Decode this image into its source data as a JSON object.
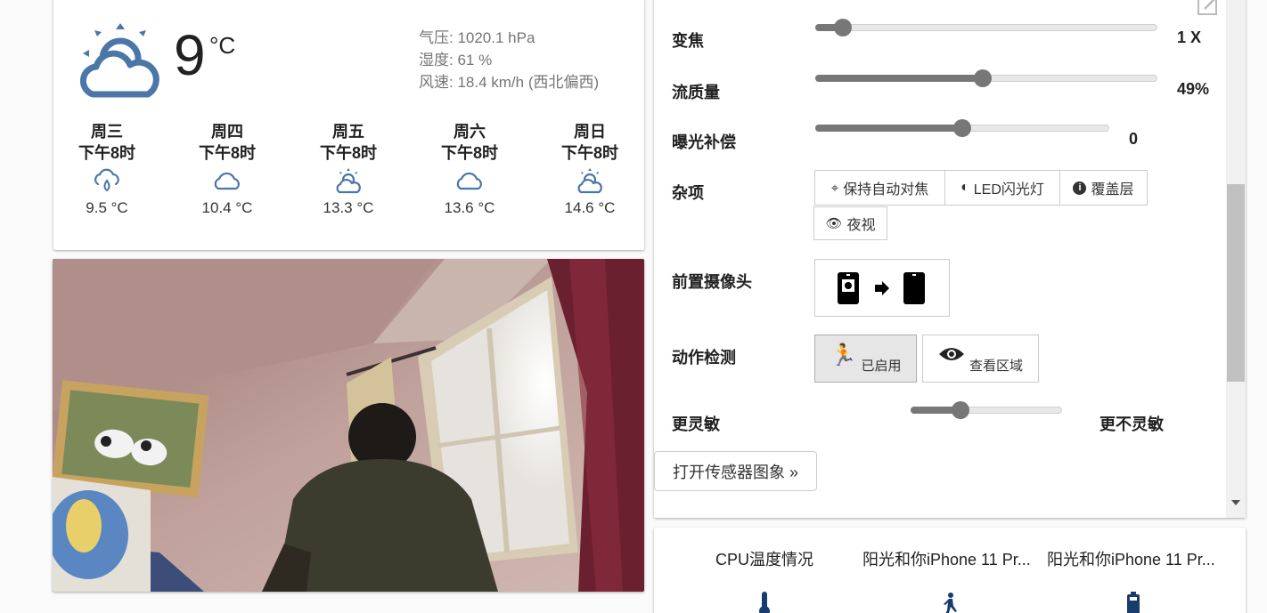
{
  "weather": {
    "current": {
      "temp": "9",
      "unit": "°C",
      "icon": "partly-cloudy-day-icon"
    },
    "pressure": "气压: 1020.1 hPa",
    "humidity": "湿度: 61 %",
    "wind": "风速: 18.4 km/h (西北偏西)",
    "forecast": [
      {
        "day": "周三",
        "time": "下午8时",
        "icon": "rain-cloud-icon",
        "temp": "9.5 °C"
      },
      {
        "day": "周四",
        "time": "下午8时",
        "icon": "cloud-icon",
        "temp": "10.4 °C"
      },
      {
        "day": "周五",
        "time": "下午8时",
        "icon": "partly-cloudy-day-icon",
        "temp": "13.3 °C"
      },
      {
        "day": "周六",
        "time": "下午8时",
        "icon": "cloud-icon",
        "temp": "13.6 °C"
      },
      {
        "day": "周日",
        "time": "下午8时",
        "icon": "partly-cloudy-day-icon",
        "temp": "14.6 °C"
      }
    ]
  },
  "controls": {
    "zoom": {
      "label": "变焦",
      "value": "1 X",
      "level": 0.08
    },
    "quality": {
      "label": "流质量",
      "value": "49%",
      "level": 0.49
    },
    "exposure": {
      "label": "曝光补偿",
      "value": "0",
      "level": 0.5
    },
    "misc": {
      "label": "杂项",
      "focus": "保持自动对焦",
      "led": "LED闪光灯",
      "overlay": "覆盖层",
      "night": "夜视"
    },
    "front_camera": {
      "label": "前置摄像头"
    },
    "motion": {
      "label": "动作检测",
      "enabled": "已启用",
      "view_area": "查看区域"
    },
    "sensitivity": {
      "label_more": "更灵敏",
      "label_less": "更不灵敏",
      "level": 0.33
    },
    "sensor_graph_button": "打开传感器图象 »"
  },
  "sensors": {
    "items": [
      {
        "title": "CPU温度情况",
        "icon": "thermometer-icon"
      },
      {
        "title": "阳光和你iPhone 11 Pr...",
        "icon": "walking-icon"
      },
      {
        "title": "阳光和你iPhone 11 Pr...",
        "icon": "battery-icon"
      }
    ]
  },
  "colors": {
    "weather_icon": "#4a76a8",
    "slider": "#777777",
    "text": "#212121"
  }
}
